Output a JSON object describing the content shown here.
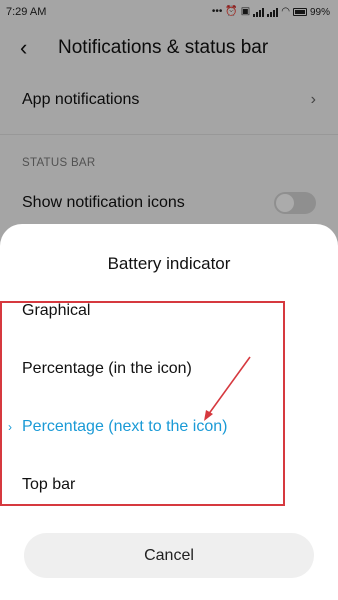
{
  "status_bar": {
    "time": "7:29 AM",
    "battery": "99%",
    "icons": [
      "dots-icon",
      "alarm-icon",
      "nfc-icon",
      "signal-icon",
      "signal-icon",
      "wifi-icon",
      "battery-icon"
    ]
  },
  "header": {
    "title": "Notifications & status bar"
  },
  "settings": {
    "app_notifications": "App notifications",
    "section_status_bar": "STATUS BAR",
    "show_notification_icons": "Show notification icons"
  },
  "dialog": {
    "title": "Battery indicator",
    "options": [
      {
        "label": "Graphical",
        "selected": false
      },
      {
        "label": "Percentage (in the icon)",
        "selected": false
      },
      {
        "label": "Percentage (next to the icon)",
        "selected": true
      },
      {
        "label": "Top bar",
        "selected": false
      }
    ],
    "cancel": "Cancel"
  },
  "colors": {
    "accent": "#1a9ad6",
    "annotation_red": "#d6393f"
  }
}
